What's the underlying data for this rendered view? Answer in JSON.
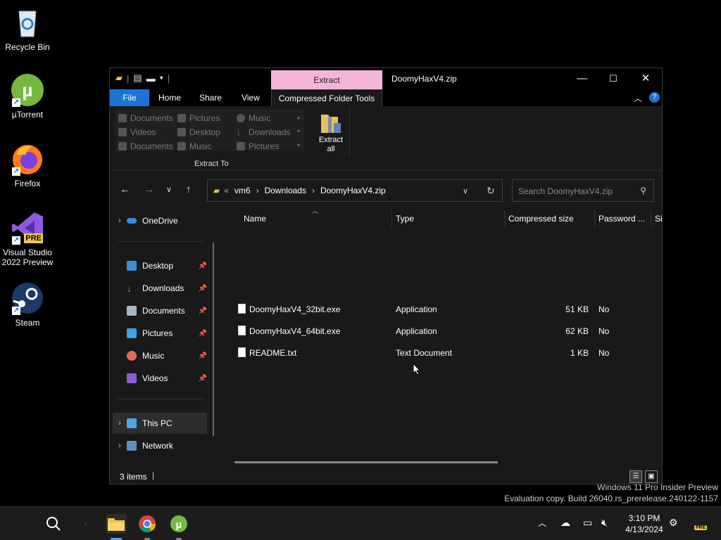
{
  "desktop": {
    "icons": [
      {
        "label": "Recycle Bin",
        "icon": "recycle-bin-icon"
      },
      {
        "label": "µTorrent",
        "icon": "utorrent-icon"
      },
      {
        "label": "Firefox",
        "icon": "firefox-icon"
      },
      {
        "label": "Visual Studio 2022 Preview",
        "badge": "PRE",
        "icon": "visual-studio-icon"
      },
      {
        "label": "Steam",
        "icon": "steam-icon"
      }
    ]
  },
  "window": {
    "title": "DoomyHaxV4.zip",
    "contextual_tab": "Extract",
    "tabs": {
      "file": "File",
      "home": "Home",
      "share": "Share",
      "view": "View",
      "compressed": "Compressed Folder Tools"
    },
    "ribbon": {
      "locations": [
        [
          "Documents",
          "Pictures",
          "Music"
        ],
        [
          "Videos",
          "Desktop",
          "Downloads"
        ],
        [
          "Documents",
          "Music",
          "Pictures"
        ]
      ],
      "extract_all_label": "Extract all",
      "group_label": "Extract To"
    },
    "address": {
      "overflow": "«",
      "crumbs": [
        "vm6",
        "Downloads",
        "DoomyHaxV4.zip"
      ]
    },
    "search_placeholder": "Search DoomyHaxV4.zip",
    "nav": {
      "onedrive": "OneDrive",
      "quick": [
        "Desktop",
        "Downloads",
        "Documents",
        "Pictures",
        "Music",
        "Videos"
      ],
      "this_pc": "This PC",
      "network": "Network"
    },
    "columns": {
      "name": "Name",
      "type": "Type",
      "size": "Compressed size",
      "password": "Password ...",
      "extra": "Si"
    },
    "files": [
      {
        "name": "DoomyHaxV4_32bit.exe",
        "type": "Application",
        "size": "51 KB",
        "password": "No"
      },
      {
        "name": "DoomyHaxV4_64bit.exe",
        "type": "Application",
        "size": "62 KB",
        "password": "No"
      },
      {
        "name": "README.txt",
        "type": "Text Document",
        "size": "1 KB",
        "password": "No"
      }
    ],
    "status": "3 items"
  },
  "watermark": {
    "line1": "Windows 11 Pro Insider Preview",
    "line2": "Evaluation copy. Build 26040.rs_prerelease.240122-1157"
  },
  "taskbar": {
    "time": "3:10 PM",
    "date": "4/13/2024",
    "pre_badge": "PRE"
  },
  "colors": {
    "accent": "#1a74d6",
    "extract_tab": "#f5b5d9"
  }
}
